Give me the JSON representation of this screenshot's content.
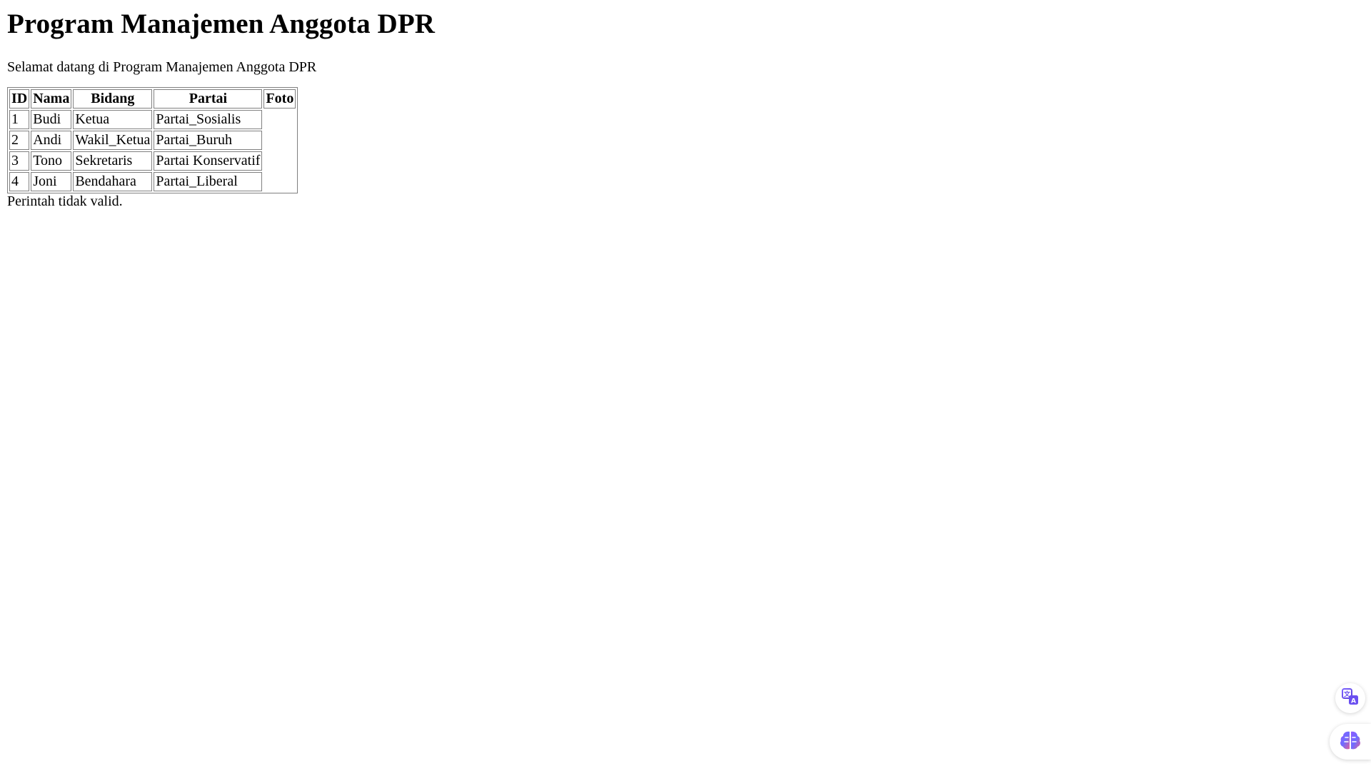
{
  "page": {
    "title": "Program Manajemen Anggota DPR",
    "welcome": "Selamat datang di Program Manajemen Anggota DPR",
    "status_message": "Perintah tidak valid."
  },
  "table": {
    "headers": [
      "ID",
      "Nama",
      "Bidang",
      "Partai",
      "Foto"
    ],
    "rows": [
      [
        "1",
        "Budi",
        "Ketua",
        "Partai_Sosialis"
      ],
      [
        "2",
        "Andi",
        "Wakil_Ketua",
        "Partai_Buruh"
      ],
      [
        "3",
        "Tono",
        "Sekretaris",
        "Partai Konservatif"
      ],
      [
        "4",
        "Joni",
        "Bendahara",
        "Partai_Liberal"
      ]
    ]
  },
  "widgets": {
    "translate_icon": "translate-icon",
    "brain_icon": "brain-icon",
    "accent_color": "#7b61ff"
  }
}
